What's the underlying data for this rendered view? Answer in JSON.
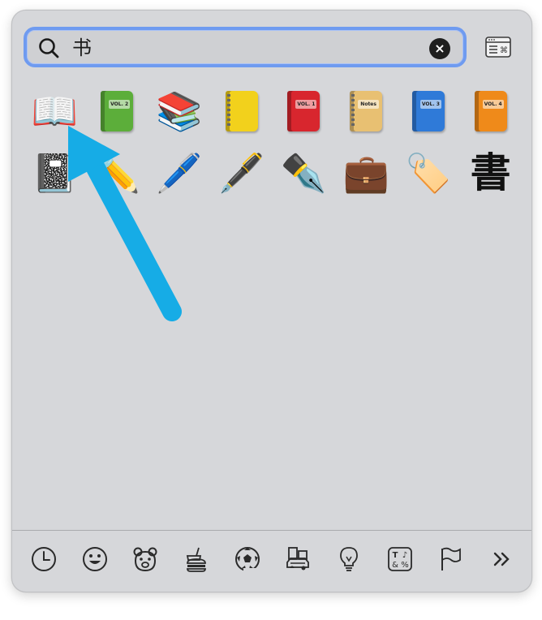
{
  "search": {
    "query": "书",
    "clear_label": "×"
  },
  "results": [
    {
      "name": "open-book",
      "glyph": "📖",
      "kind": "emoji"
    },
    {
      "name": "green-book",
      "kind": "book",
      "color": "#5cae3a",
      "label": "VOL. 2"
    },
    {
      "name": "books-stack",
      "glyph": "📚",
      "kind": "emoji"
    },
    {
      "name": "yellow-notebook",
      "kind": "notebook",
      "color": "#f2d11c"
    },
    {
      "name": "red-book",
      "kind": "book",
      "color": "#d8262e",
      "label": "VOL. 1"
    },
    {
      "name": "ledger",
      "kind": "notebook",
      "color": "#e8c072",
      "label": "Notes"
    },
    {
      "name": "blue-book",
      "kind": "book",
      "color": "#2f7ad8",
      "label": "VOL. 3"
    },
    {
      "name": "orange-book",
      "kind": "book",
      "color": "#ef8a1a",
      "label": "VOL. 4"
    },
    {
      "name": "composition-notebook",
      "glyph": "📓",
      "kind": "emoji"
    },
    {
      "name": "pencil",
      "glyph": "✏️",
      "kind": "emoji"
    },
    {
      "name": "pen",
      "glyph": "🖊️",
      "kind": "emoji"
    },
    {
      "name": "fountain-pen",
      "glyph": "🖋️",
      "kind": "emoji"
    },
    {
      "name": "fountain-pen-alt",
      "glyph": "✒️",
      "kind": "emoji"
    },
    {
      "name": "briefcase",
      "glyph": "💼",
      "kind": "emoji"
    },
    {
      "name": "bookmark-tag",
      "glyph": "🏷️",
      "kind": "emoji"
    },
    {
      "name": "kanji-sho",
      "glyph": "書",
      "kind": "kanji"
    }
  ],
  "categories": [
    {
      "name": "recent-icon"
    },
    {
      "name": "smileys-icon"
    },
    {
      "name": "animals-icon"
    },
    {
      "name": "food-icon"
    },
    {
      "name": "activity-icon"
    },
    {
      "name": "travel-icon"
    },
    {
      "name": "objects-icon"
    },
    {
      "name": "symbols-icon"
    },
    {
      "name": "flags-icon"
    },
    {
      "name": "more-icon"
    }
  ],
  "colors": {
    "panel": "#d6d7da",
    "focus_ring": "#6f9bf0",
    "annotation_arrow": "#16ace6"
  }
}
